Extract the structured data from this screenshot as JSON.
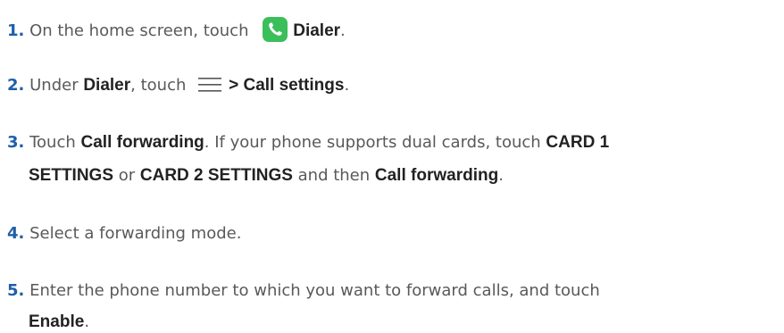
{
  "steps": [
    {
      "num": "1.",
      "t1": "On the home screen, touch ",
      "b1": "Dialer",
      "t2": "."
    },
    {
      "num": "2.",
      "t1": "Under ",
      "b1": "Dialer",
      "t2": ", touch ",
      "b2": "> Call settings",
      "t3": "."
    },
    {
      "num": "3.",
      "t1": "Touch ",
      "b1": "Call forwarding",
      "t2": ". If your phone supports dual cards, touch ",
      "b2": "CARD 1",
      "b3": "SETTINGS",
      "t3": " or ",
      "b4": "CARD 2 SETTINGS",
      "t4": " and then ",
      "b5": "Call forwarding",
      "t5": "."
    },
    {
      "num": "4.",
      "t1": "Select a forwarding mode."
    },
    {
      "num": "5.",
      "t1": "Enter the phone number to which you want to forward calls, and touch",
      "b1": "Enable",
      "t2": "."
    }
  ],
  "icons": {
    "dialer": "dialer-icon",
    "menu": "menu-icon"
  },
  "colors": {
    "number": "#1f5fa8",
    "dialer_icon": "#3bbf5a"
  }
}
